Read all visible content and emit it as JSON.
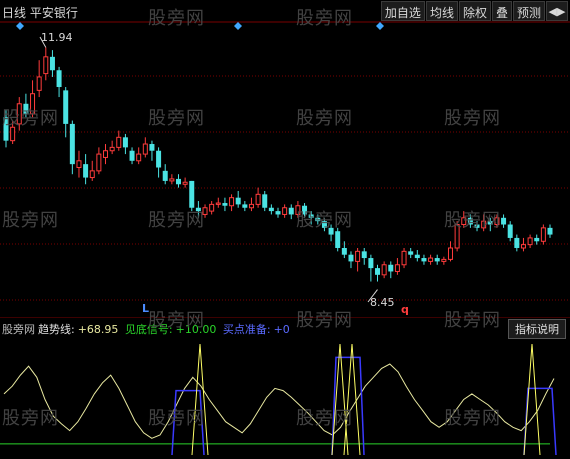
{
  "app": {
    "title": "日线 平安银行"
  },
  "toolbar": {
    "items": [
      "加自选",
      "均线",
      "除权",
      "叠",
      "预测"
    ],
    "arrow_icon": "toggle-arrows-icon"
  },
  "main_chart": {
    "high_label": "11.94",
    "low_label": "8.45",
    "marker_l": "L",
    "marker_q": "q",
    "colors": {
      "up": "#ff3c3c",
      "down": "#4be3e3",
      "grid": "#7a0000",
      "diamond": "#3fa7ff"
    }
  },
  "indicator": {
    "watermark_label": "股旁网",
    "trend_name": "趋势线:",
    "trend_value": "+68.95",
    "signal_name": "见底信号:",
    "signal_value": "+10.00",
    "buy_name": "买点准备:",
    "buy_value": "+0",
    "explain_button": "指标说明",
    "colors": {
      "trend": "#e8e8a0",
      "signal": "#2ad42a",
      "buy": "#3a3aff"
    }
  },
  "watermark": "股旁网",
  "chart_data": {
    "type": "candlestick",
    "high": 11.94,
    "low": 8.45,
    "candles": [
      [
        10.9,
        10.55,
        11.0,
        10.45
      ],
      [
        10.55,
        10.75,
        10.85,
        10.5
      ],
      [
        10.8,
        11.1,
        11.2,
        10.7
      ],
      [
        11.1,
        10.95,
        11.25,
        10.9
      ],
      [
        10.95,
        11.25,
        11.45,
        10.9
      ],
      [
        11.3,
        11.5,
        11.75,
        11.2
      ],
      [
        11.55,
        11.8,
        11.94,
        11.45
      ],
      [
        11.8,
        11.6,
        11.9,
        11.5
      ],
      [
        11.6,
        11.35,
        11.65,
        11.2
      ],
      [
        11.3,
        10.8,
        11.35,
        10.6
      ],
      [
        10.8,
        10.2,
        10.85,
        10.05
      ],
      [
        10.15,
        10.25,
        10.4,
        10.0
      ],
      [
        10.2,
        10.0,
        10.35,
        9.9
      ],
      [
        10.0,
        10.1,
        10.25,
        9.95
      ],
      [
        10.1,
        10.35,
        10.45,
        10.05
      ],
      [
        10.3,
        10.4,
        10.5,
        10.2
      ],
      [
        10.4,
        10.45,
        10.55,
        10.35
      ],
      [
        10.45,
        10.6,
        10.7,
        10.4
      ],
      [
        10.6,
        10.45,
        10.65,
        10.35
      ],
      [
        10.4,
        10.25,
        10.45,
        10.2
      ],
      [
        10.25,
        10.35,
        10.45,
        10.2
      ],
      [
        10.35,
        10.5,
        10.6,
        10.3
      ],
      [
        10.5,
        10.4,
        10.55,
        10.25
      ],
      [
        10.4,
        10.15,
        10.45,
        10.0
      ],
      [
        10.1,
        9.95,
        10.2,
        9.9
      ],
      [
        9.95,
        9.98,
        10.05,
        9.9
      ],
      [
        9.98,
        9.9,
        10.05,
        9.85
      ],
      [
        9.9,
        9.93,
        10.0,
        9.85
      ],
      [
        9.95,
        9.55,
        9.95,
        9.5
      ],
      [
        9.55,
        9.5,
        9.65,
        9.4
      ],
      [
        9.45,
        9.55,
        9.6,
        9.4
      ],
      [
        9.5,
        9.6,
        9.65,
        9.45
      ],
      [
        9.6,
        9.62,
        9.7,
        9.55
      ],
      [
        9.62,
        9.58,
        9.7,
        9.5
      ],
      [
        9.58,
        9.7,
        9.75,
        9.5
      ],
      [
        9.7,
        9.6,
        9.8,
        9.55
      ],
      [
        9.6,
        9.55,
        9.65,
        9.5
      ],
      [
        9.55,
        9.6,
        9.7,
        9.5
      ],
      [
        9.6,
        9.75,
        9.85,
        9.55
      ],
      [
        9.75,
        9.55,
        9.8,
        9.5
      ],
      [
        9.55,
        9.5,
        9.6,
        9.45
      ],
      [
        9.5,
        9.45,
        9.55,
        9.4
      ],
      [
        9.45,
        9.55,
        9.6,
        9.4
      ],
      [
        9.55,
        9.45,
        9.6,
        9.38
      ],
      [
        9.45,
        9.58,
        9.65,
        9.4
      ],
      [
        9.58,
        9.45,
        9.62,
        9.4
      ],
      [
        9.45,
        9.4,
        9.5,
        9.3
      ],
      [
        9.4,
        9.35,
        9.45,
        9.3
      ],
      [
        9.35,
        9.25,
        9.4,
        9.2
      ],
      [
        9.25,
        9.15,
        9.3,
        9.05
      ],
      [
        9.2,
        8.95,
        9.25,
        8.9
      ],
      [
        8.95,
        8.85,
        9.05,
        8.8
      ],
      [
        8.85,
        8.75,
        8.9,
        8.65
      ],
      [
        8.75,
        8.9,
        8.95,
        8.6
      ],
      [
        8.9,
        8.8,
        8.95,
        8.7
      ],
      [
        8.8,
        8.65,
        8.85,
        8.45
      ],
      [
        8.65,
        8.55,
        8.7,
        8.45
      ],
      [
        8.55,
        8.7,
        8.75,
        8.5
      ],
      [
        8.7,
        8.6,
        8.75,
        8.5
      ],
      [
        8.6,
        8.7,
        8.8,
        8.55
      ],
      [
        8.7,
        8.9,
        8.95,
        8.65
      ],
      [
        8.9,
        8.85,
        8.95,
        8.8
      ],
      [
        8.85,
        8.8,
        8.92,
        8.75
      ],
      [
        8.8,
        8.75,
        8.85,
        8.7
      ],
      [
        8.75,
        8.8,
        8.85,
        8.7
      ],
      [
        8.8,
        8.75,
        8.85,
        8.7
      ],
      [
        8.75,
        8.78,
        8.82,
        8.7
      ],
      [
        8.78,
        8.95,
        9.05,
        8.75
      ],
      [
        8.95,
        9.3,
        9.35,
        8.9
      ],
      [
        9.3,
        9.4,
        9.5,
        9.25
      ],
      [
        9.4,
        9.3,
        9.45,
        9.25
      ],
      [
        9.3,
        9.25,
        9.35,
        9.2
      ],
      [
        9.25,
        9.35,
        9.45,
        9.2
      ],
      [
        9.35,
        9.3,
        9.4,
        9.2
      ],
      [
        9.3,
        9.4,
        9.45,
        9.25
      ],
      [
        9.4,
        9.3,
        9.45,
        9.25
      ],
      [
        9.3,
        9.1,
        9.35,
        9.05
      ],
      [
        9.1,
        8.95,
        9.15,
        8.9
      ],
      [
        8.95,
        9.0,
        9.1,
        8.9
      ],
      [
        9.0,
        9.1,
        9.15,
        8.95
      ],
      [
        9.1,
        9.05,
        9.15,
        9.0
      ],
      [
        9.05,
        9.25,
        9.3,
        9.0
      ],
      [
        9.25,
        9.15,
        9.3,
        9.1
      ]
    ],
    "trend_line": [
      55,
      62,
      72,
      80,
      70,
      50,
      35,
      28,
      22,
      30,
      42,
      55,
      65,
      72,
      60,
      45,
      30,
      20,
      15,
      18,
      30,
      45,
      60,
      70,
      62,
      50,
      40,
      30,
      25,
      20,
      28,
      40,
      52,
      60,
      58,
      52,
      45,
      38,
      30,
      22,
      18,
      25,
      38,
      50,
      62,
      70,
      78,
      82,
      75,
      62,
      50,
      40,
      30,
      25,
      30,
      40,
      50,
      55,
      50,
      45,
      38,
      30,
      25,
      22,
      30,
      40,
      55,
      68.95
    ],
    "signal_line": 10,
    "buy_line": 0
  }
}
